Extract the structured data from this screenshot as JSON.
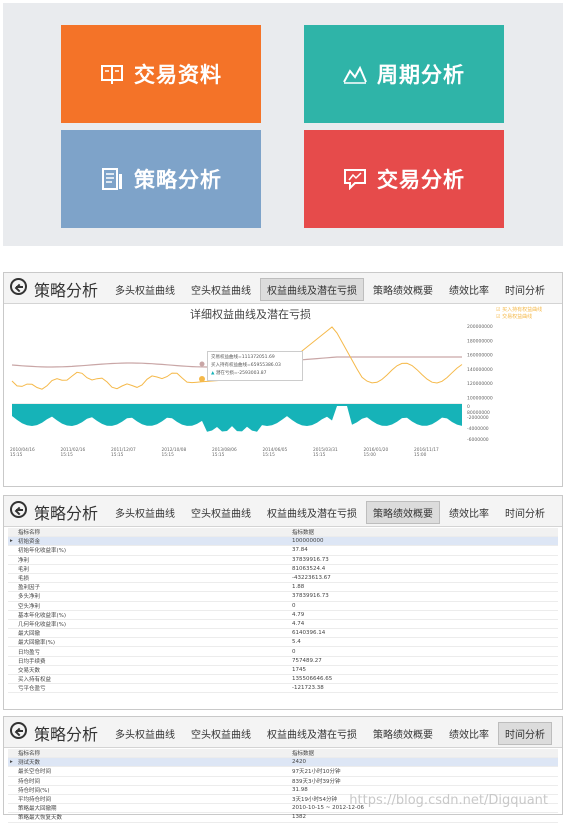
{
  "tiles": [
    {
      "label": "交易资料",
      "icon": "book-icon",
      "color": "#f47328"
    },
    {
      "label": "周期分析",
      "icon": "trend-line-icon",
      "color": "#2fb4a8"
    },
    {
      "label": "策略分析",
      "icon": "document-icon",
      "color": "#7ea3c9"
    },
    {
      "label": "交易分析",
      "icon": "chat-chart-icon",
      "color": "#e64b4b"
    }
  ],
  "page_title": "策略分析",
  "tabs": [
    "多头权益曲线",
    "空头权益曲线",
    "权益曲线及潜在亏损",
    "策略绩效概要",
    "绩效比率",
    "时间分析"
  ],
  "panel1": {
    "active_tab": 2,
    "chart_title": "详细权益曲线及潜在亏损",
    "legend": [
      "买入持有权益曲线",
      "交易权益曲线"
    ],
    "tooltip": [
      "交易权益曲线=111372051.69",
      "买入持有权益曲线=65955386.03",
      "潜在亏损=-2593003.87"
    ],
    "y_right_ticks": [
      "200000000",
      "180000000",
      "160000000",
      "140000000",
      "120000000",
      "100000000",
      "80000000"
    ],
    "y_dd_ticks": [
      "0",
      "-2000000",
      "-4000000",
      "-6000000"
    ],
    "x_ticks": [
      "2010/04/16\n15:15",
      "2011/02/16\n15:15",
      "2011/12/07\n15:15",
      "2012/10/08\n15:15",
      "2013/08/06\n15:15",
      "2014/06/05\n15:15",
      "2015/03/31\n15:15",
      "2016/01/20\n15:00",
      "2016/11/17\n15:00"
    ]
  },
  "panel2": {
    "active_tab": 3,
    "header": [
      "指标名称",
      "指标数据"
    ],
    "rows": [
      [
        "初始资金",
        "100000000"
      ],
      [
        "初始年化收益率(%)",
        "37.84"
      ],
      [
        "净利",
        "37839916.73"
      ],
      [
        "毛利",
        "81063524.4"
      ],
      [
        "毛损",
        "-43223613.67"
      ],
      [
        "盈利因子",
        "1.88"
      ],
      [
        "多头净利",
        "37839916.73"
      ],
      [
        "空头净利",
        "0"
      ],
      [
        "基本年化收益率(%)",
        "4.79"
      ],
      [
        "几何年化收益率(%)",
        "4.74"
      ],
      [
        "最大回撤",
        "6140396.14"
      ],
      [
        "最大回撤率(%)",
        "5.4"
      ],
      [
        "日均盈亏",
        "0"
      ],
      [
        "日均手续费",
        "757489.27"
      ],
      [
        "交易天数",
        "1745"
      ],
      [
        "买入持有权益",
        "135506646.65"
      ],
      [
        "亏平仓盈亏",
        "-121723.38"
      ]
    ]
  },
  "panel3": {
    "active_tab": 5,
    "header": [
      "指标名称",
      "指标数据"
    ],
    "rows": [
      [
        "测试天数",
        "2420"
      ],
      [
        "最长空仓时间",
        "97天21小时10分钟"
      ],
      [
        "持仓时间",
        "839天3小时39分钟"
      ],
      [
        "持仓时间(%)",
        "31.98"
      ],
      [
        "平均持仓时间",
        "3天19小时54分钟"
      ],
      [
        "策略最大回撤期",
        "2010-10-15 ~ 2012-12-06"
      ],
      [
        "策略最大恢复天数",
        "1382"
      ]
    ]
  },
  "watermark": "https://blog.csdn.net/Digquant",
  "colors": {
    "equity": "#f5b94a",
    "buyhold": "#c9a6a6",
    "drawdown": "#16b3b8"
  }
}
